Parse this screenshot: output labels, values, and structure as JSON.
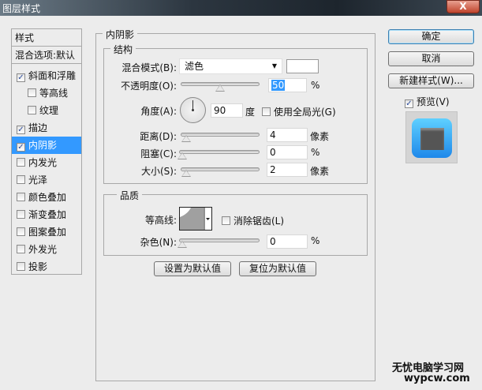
{
  "window": {
    "title": "图层样式",
    "close": "X"
  },
  "styles": {
    "header": "样式",
    "blend_options": "混合选项:默认",
    "items": [
      {
        "label": "斜面和浮雕",
        "checked": true,
        "indent": false
      },
      {
        "label": "等高线",
        "checked": false,
        "indent": true
      },
      {
        "label": "纹理",
        "checked": false,
        "indent": true
      },
      {
        "label": "描边",
        "checked": true,
        "indent": false
      },
      {
        "label": "内阴影",
        "checked": true,
        "indent": false,
        "selected": true
      },
      {
        "label": "内发光",
        "checked": false,
        "indent": false
      },
      {
        "label": "光泽",
        "checked": false,
        "indent": false
      },
      {
        "label": "颜色叠加",
        "checked": false,
        "indent": false
      },
      {
        "label": "渐变叠加",
        "checked": false,
        "indent": false
      },
      {
        "label": "图案叠加",
        "checked": false,
        "indent": false
      },
      {
        "label": "外发光",
        "checked": false,
        "indent": false
      },
      {
        "label": "投影",
        "checked": false,
        "indent": false
      }
    ]
  },
  "panel": {
    "title": "内阴影",
    "structure": {
      "title": "结构",
      "blend_mode_label": "混合模式(B):",
      "blend_mode": "滤色",
      "color": "#ffffff",
      "opacity_label": "不透明度(O):",
      "opacity": "50",
      "opacity_unit": "%",
      "opacity_pct": 50,
      "angle_label": "角度(A):",
      "angle": "90",
      "angle_unit": "度",
      "global_light": "使用全局光(G)",
      "global_light_checked": false,
      "distance_label": "距离(D):",
      "distance": "4",
      "distance_unit": "像素",
      "choke_label": "阻塞(C):",
      "choke": "0",
      "choke_unit": "%",
      "size_label": "大小(S):",
      "size": "2",
      "size_unit": "像素"
    },
    "quality": {
      "title": "品质",
      "contour_label": "等高线:",
      "antialias": "消除锯齿(L)",
      "antialias_checked": false,
      "noise_label": "杂色(N):",
      "noise": "0",
      "noise_unit": "%"
    },
    "make_default": "设置为默认值",
    "reset_default": "复位为默认值"
  },
  "buttons": {
    "ok": "确定",
    "cancel": "取消",
    "new_style": "新建样式(W)...",
    "preview": "预览(V)",
    "preview_checked": true
  },
  "watermark": {
    "line1": "无忧电脑学习网",
    "line2": "wypcw.com"
  }
}
